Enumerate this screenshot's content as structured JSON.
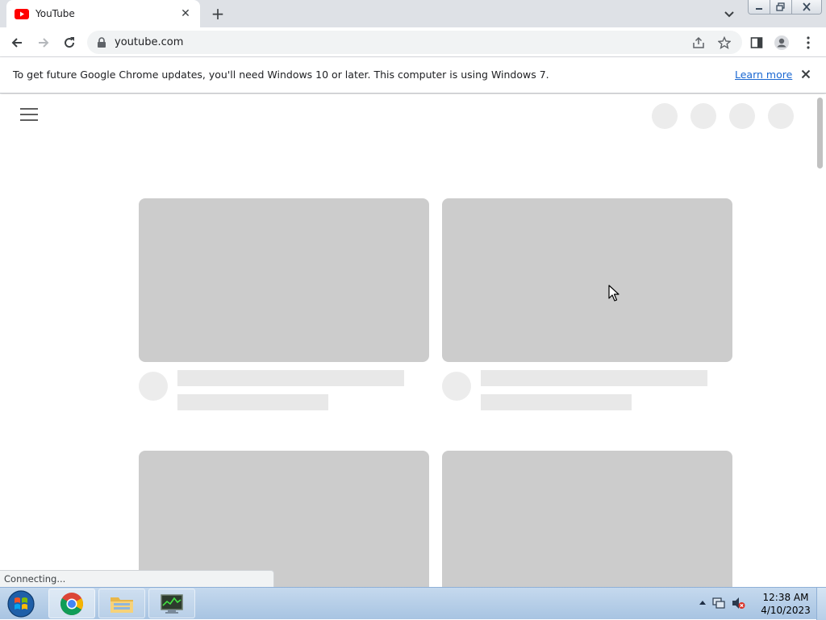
{
  "browser": {
    "tab": {
      "title": "YouTube"
    },
    "address": {
      "url": "youtube.com"
    }
  },
  "infobar": {
    "message": "To get future Google Chrome updates, you'll need Windows 10 or later. This computer is using Windows 7.",
    "link": "Learn more"
  },
  "status": {
    "text": "Connecting..."
  },
  "taskbar": {
    "time": "12:38 AM",
    "date": "4/10/2023",
    "items": [
      "chrome-icon",
      "file-explorer-icon",
      "task-manager-icon"
    ]
  },
  "colors": {
    "skeleton_thumb": "#cccccc",
    "skeleton_light": "#ececec",
    "youtube_red": "#ff0000",
    "link_blue": "#1967d2"
  }
}
